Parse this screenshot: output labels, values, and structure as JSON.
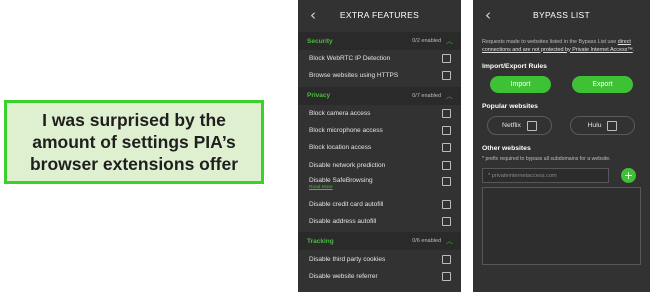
{
  "caption": {
    "text": "I was surprised by the\namount of settings PIA’s\nbrowser extensions offer"
  },
  "extra_features": {
    "back_icon": "chevron-left-icon",
    "title": "EXTRA FEATURES",
    "sections": [
      {
        "name": "Security",
        "count": "0/2 enabled",
        "items": [
          {
            "label": "Block WebRTC IP Detection"
          },
          {
            "label": "Browse websites using HTTPS"
          }
        ]
      },
      {
        "name": "Privacy",
        "count": "0/7 enabled",
        "items": [
          {
            "label": "Block camera access"
          },
          {
            "label": "Block microphone access"
          },
          {
            "label": "Block location access"
          },
          {
            "label": "Disable network prediction"
          },
          {
            "label": "Disable SafeBrowsing",
            "sublink": "Read More"
          },
          {
            "label": "Disable credit card autofill"
          },
          {
            "label": "Disable address autofill"
          }
        ]
      },
      {
        "name": "Tracking",
        "count": "0/6 enabled",
        "items": [
          {
            "label": "Disable third party cookies"
          },
          {
            "label": "Disable website referrer"
          }
        ]
      }
    ]
  },
  "bypass_list": {
    "back_icon": "chevron-left-icon",
    "title": "BYPASS LIST",
    "description_prefix": "Requests made to websites listed in the Bypass List use ",
    "description_link": "direct connections and are not protected by Private Internet Access™",
    "description_suffix": ".",
    "import_export_heading": "Import/Export Rules",
    "import_label": "Import",
    "export_label": "Export",
    "popular_heading": "Popular websites",
    "popular": [
      {
        "label": "Netflix"
      },
      {
        "label": "Hulu"
      }
    ],
    "other_heading": "Other websites",
    "note": "* prefix required to bypass all subdomains for a website.",
    "input_placeholder": "* privateinternetaccess.com",
    "add_icon": "plus-icon",
    "add_label": "+"
  }
}
